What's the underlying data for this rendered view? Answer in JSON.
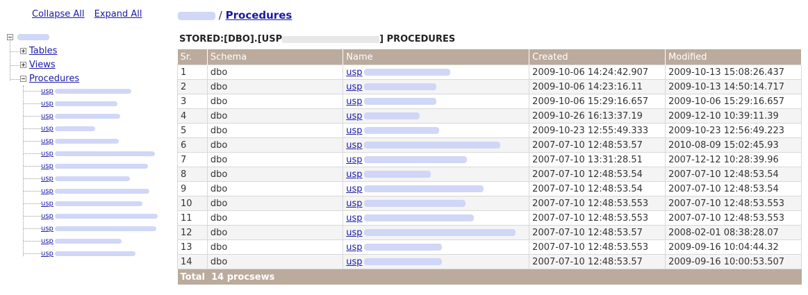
{
  "tree": {
    "collapse_all": "Collapse All",
    "expand_all": "Expand All",
    "nodes": {
      "tables": "Tables",
      "views": "Views",
      "procedures": "Procedures"
    },
    "proc_prefix": "usp"
  },
  "breadcrumb": {
    "separator": "/",
    "current": "Procedures"
  },
  "heading": {
    "prefix": "STORED:[DBO].[USP",
    "suffix": "] PROCEDURES"
  },
  "table": {
    "columns": [
      "Sr.",
      "Schema",
      "Name",
      "Created",
      "Modified"
    ],
    "name_prefix": "usp",
    "rows": [
      {
        "sr": "1",
        "schema": "dbo",
        "created": "2009-10-06 14:24:42.907",
        "modified": "2009-10-13 15:08:26.437"
      },
      {
        "sr": "2",
        "schema": "dbo",
        "created": "2009-10-06 14:23:16.11",
        "modified": "2009-10-13 14:50:14.717"
      },
      {
        "sr": "3",
        "schema": "dbo",
        "created": "2009-10-06 15:29:16.657",
        "modified": "2009-10-06 15:29:16.657"
      },
      {
        "sr": "4",
        "schema": "dbo",
        "created": "2009-10-26 16:13:37.19",
        "modified": "2009-12-10 10:39:11.39"
      },
      {
        "sr": "5",
        "schema": "dbo",
        "created": "2009-10-23 12:55:49.333",
        "modified": "2009-10-23 12:56:49.223"
      },
      {
        "sr": "6",
        "schema": "dbo",
        "created": "2007-07-10 12:48:53.57",
        "modified": "2010-08-09 15:02:45.93"
      },
      {
        "sr": "7",
        "schema": "dbo",
        "created": "2007-07-10 13:31:28.51",
        "modified": "2007-12-12 10:28:39.96"
      },
      {
        "sr": "8",
        "schema": "dbo",
        "created": "2007-07-10 12:48:53.54",
        "modified": "2007-07-10 12:48:53.54"
      },
      {
        "sr": "9",
        "schema": "dbo",
        "created": "2007-07-10 12:48:53.54",
        "modified": "2007-07-10 12:48:53.54"
      },
      {
        "sr": "10",
        "schema": "dbo",
        "created": "2007-07-10 12:48:53.553",
        "modified": "2007-07-10 12:48:53.553"
      },
      {
        "sr": "11",
        "schema": "dbo",
        "created": "2007-07-10 12:48:53.553",
        "modified": "2007-07-10 12:48:53.553"
      },
      {
        "sr": "12",
        "schema": "dbo",
        "created": "2007-07-10 12:48:53.57",
        "modified": "2008-02-01 08:38:28.07"
      },
      {
        "sr": "13",
        "schema": "dbo",
        "created": "2007-07-10 12:48:53.553",
        "modified": "2009-09-16 10:04:44.32"
      },
      {
        "sr": "14",
        "schema": "dbo",
        "created": "2007-07-10 12:48:53.57",
        "modified": "2009-09-16 10:00:53.507"
      }
    ],
    "footer_label": "Total",
    "footer_count": "14 procsews"
  },
  "colors": {
    "header_bg": "#bbab9c",
    "link": "#1a1aa6",
    "redacted": "#c9d0f5"
  }
}
